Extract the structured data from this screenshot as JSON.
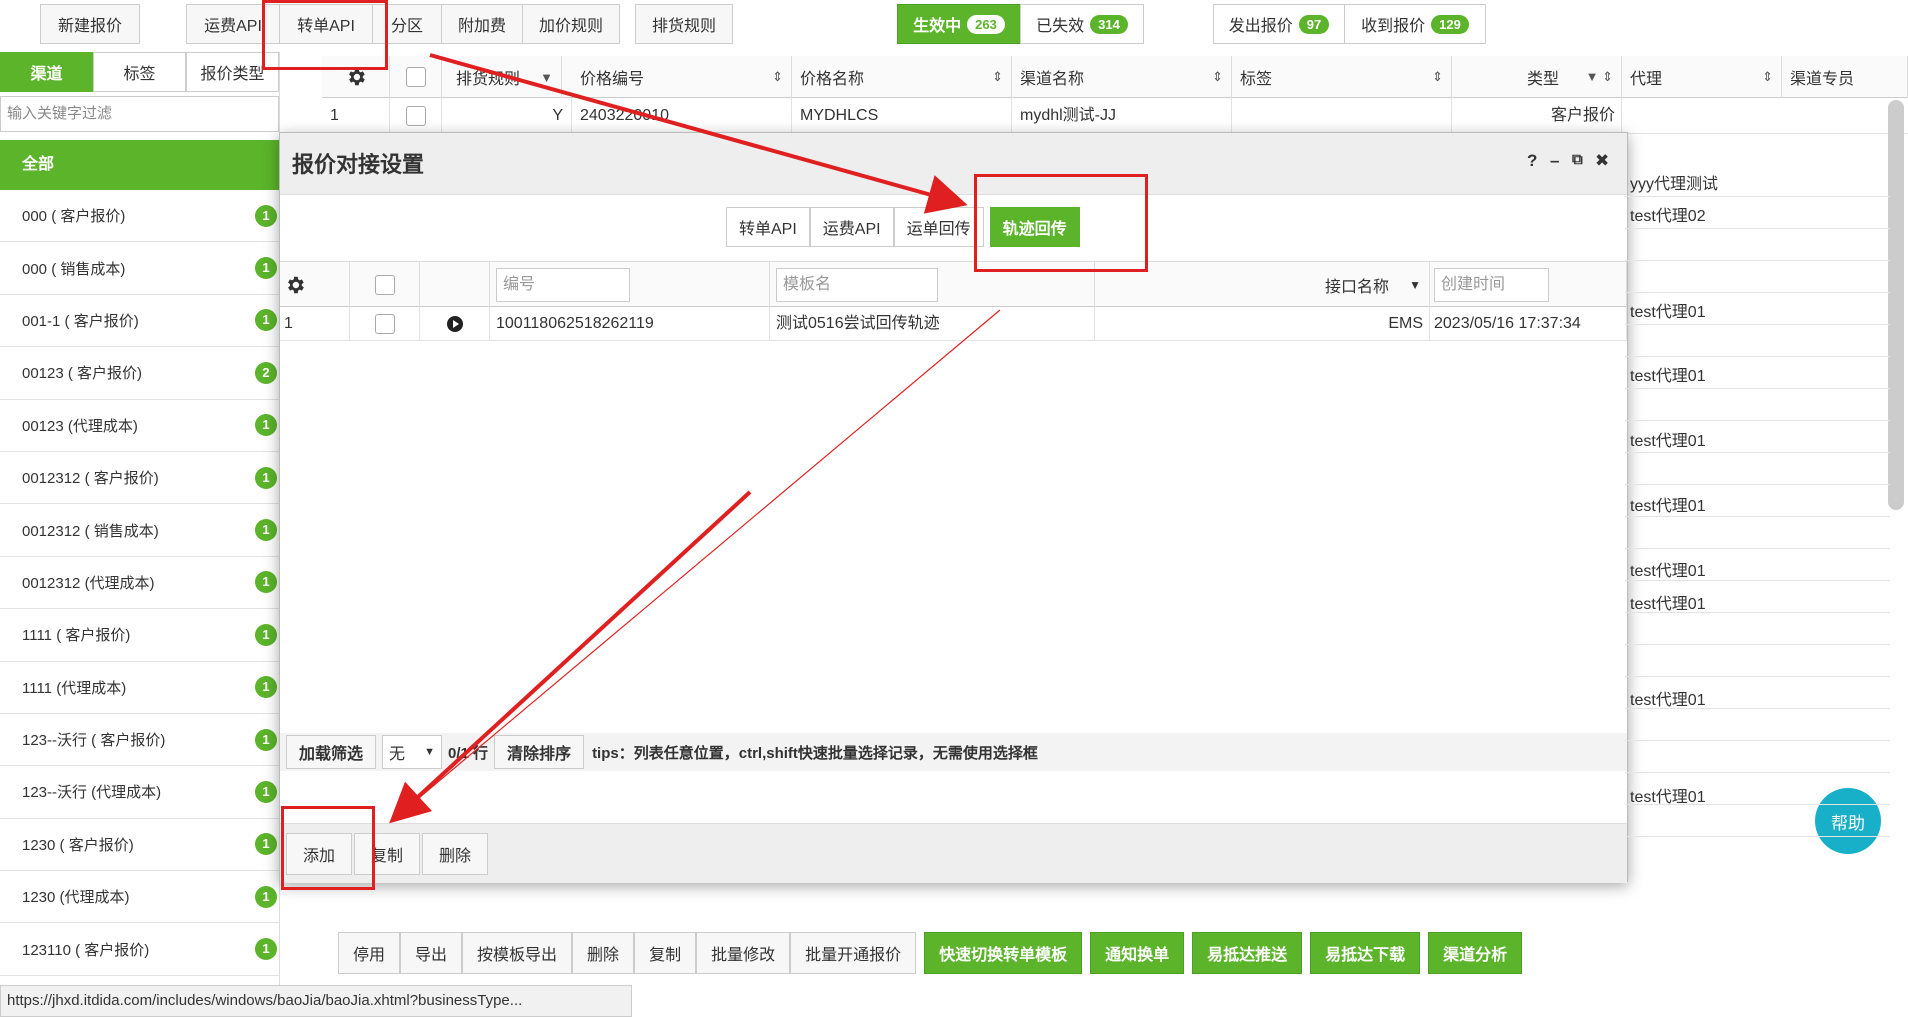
{
  "toolbar": {
    "new_quote": "新建报价",
    "freight_api": "运费API",
    "order_api": "转单API",
    "zone": "分区",
    "surcharge": "附加费",
    "markup_rule": "加价规则",
    "cargo_rule": "排货规则",
    "active": {
      "label": "生效中",
      "count": "263"
    },
    "expired": {
      "label": "已失效",
      "count": "314"
    },
    "sent": {
      "label": "发出报价",
      "count": "97"
    },
    "received": {
      "label": "收到报价",
      "count": "129"
    }
  },
  "sidebar": {
    "tabs": [
      "渠道",
      "标签",
      "报价类型"
    ],
    "filter_placeholder": "输入关键字过滤",
    "all_label": "全部",
    "items": [
      {
        "label": "000 ( 客户报价)",
        "count": "1"
      },
      {
        "label": "000 ( 销售成本)",
        "count": "1"
      },
      {
        "label": "001-1 ( 客户报价)",
        "count": "1"
      },
      {
        "label": "00123 ( 客户报价)",
        "count": "2"
      },
      {
        "label": "00123 (代理成本)",
        "count": "1"
      },
      {
        "label": "0012312 ( 客户报价)",
        "count": "1"
      },
      {
        "label": "0012312 ( 销售成本)",
        "count": "1"
      },
      {
        "label": "0012312 (代理成本)",
        "count": "1"
      },
      {
        "label": "1111 ( 客户报价)",
        "count": "1"
      },
      {
        "label": "1111 (代理成本)",
        "count": "1"
      },
      {
        "label": "123--沃行 ( 客户报价)",
        "count": "1"
      },
      {
        "label": "123--沃行 (代理成本)",
        "count": "1"
      },
      {
        "label": "1230 ( 客户报价)",
        "count": "1"
      },
      {
        "label": "1230 (代理成本)",
        "count": "1"
      },
      {
        "label": "123110 ( 客户报价)",
        "count": "1"
      }
    ]
  },
  "grid": {
    "columns": {
      "cargo_rule": "排货规则",
      "price_no": "价格编号",
      "price_name": "价格名称",
      "channel_name": "渠道名称",
      "tag": "标签",
      "type": "类型",
      "agent": "代理",
      "channel_owner": "渠道专员"
    },
    "first_row": {
      "index": "1",
      "cargo_flag": "Y",
      "price_no": "2403220010",
      "price_name": "MYDHLCS",
      "channel_name": "mydhl测试-JJ",
      "type": "客户报价"
    },
    "agents": [
      "yyy代理测试",
      "test代理02",
      "test代理01",
      "test代理01",
      "test代理01",
      "test代理01",
      "test代理01",
      "test代理01",
      "test代理01",
      "test代理01"
    ]
  },
  "bottom_actions": {
    "plain": [
      "停用",
      "导出",
      "按模板导出",
      "删除",
      "复制",
      "批量修改",
      "批量开通报价"
    ],
    "green": [
      "快速切换转单模板",
      "通知换单",
      "易抵达推送",
      "易抵达下载",
      "渠道分析"
    ]
  },
  "status_url": "https://jhxd.itdida.com/includes/windows/baoJia/baoJia.xhtml?businessType...",
  "help_label": "帮助",
  "modal": {
    "title": "报价对接设置",
    "controls": {
      "help": "?",
      "minimize": "–",
      "popout": "⧉",
      "close": "✖"
    },
    "tabs": [
      "转单API",
      "运费API",
      "运单回传",
      "轨迹回传"
    ],
    "columns": {
      "no_placeholder": "编号",
      "template_placeholder": "模板名",
      "interface_name": "接口名称",
      "created_placeholder": "创建时间"
    },
    "row": {
      "index": "1",
      "no": "100118062518262119",
      "template": "测试0516尝试回传轨迹",
      "interface": "EMS",
      "created": "2023/05/16 17:37:34"
    },
    "footer": {
      "load_filter": "加载筛选",
      "none_option": "无",
      "row_count": "0/1 行",
      "clear_sort": "清除排序",
      "tips": "tips：列表任意位置，ctrl,shift快速批量选择记录，无需使用选择框"
    },
    "actions": {
      "add": "添加",
      "copy": "复制",
      "delete": "删除"
    }
  },
  "colors": {
    "accent": "#5bb42a",
    "annotation": "#e02020",
    "help": "#17b0c8"
  }
}
